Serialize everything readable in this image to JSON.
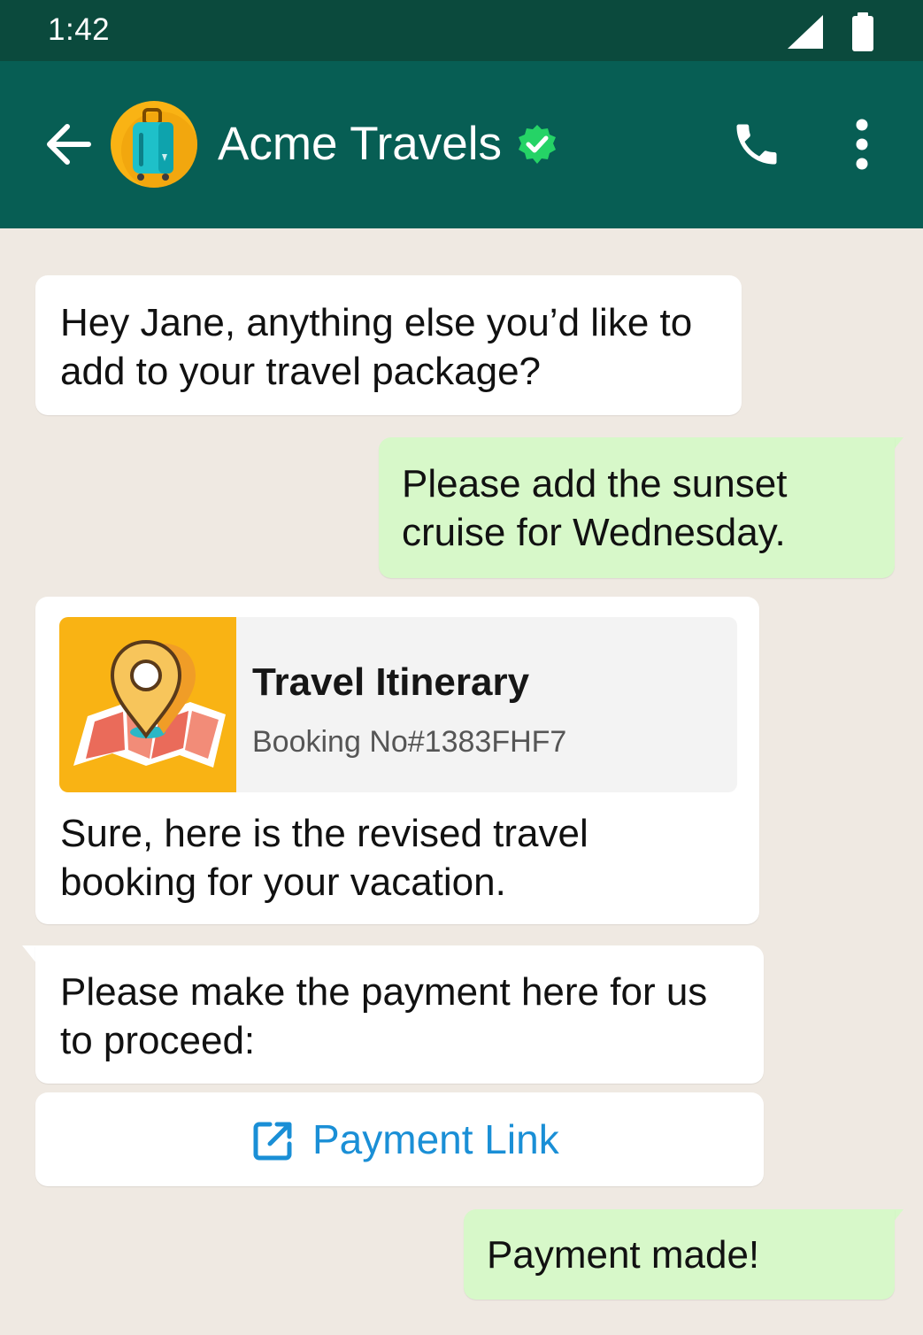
{
  "status_bar": {
    "time": "1:42",
    "signal_icon": "cellular-signal-icon",
    "battery_icon": "battery-icon"
  },
  "header": {
    "contact_name": "Acme Travels",
    "avatar_icon": "suitcase-icon",
    "verified_icon": "verified-badge-icon",
    "back_icon": "back-arrow-icon",
    "call_icon": "phone-call-icon",
    "menu_icon": "more-vert-icon"
  },
  "messages": [
    {
      "direction": "incoming",
      "text": "Hey Jane, anything else you’d like to\nadd to your travel package?"
    },
    {
      "direction": "outgoing",
      "text": "Please add the sunset\ncruise for Wednesday."
    },
    {
      "direction": "incoming",
      "card": {
        "title": "Travel Itinerary",
        "subtitle": "Booking No#1383FHF7",
        "icon": "map-pin-icon"
      },
      "text": "Sure, here is the revised travel\nbooking for your vacation."
    },
    {
      "direction": "incoming",
      "text": "Please make the payment here for us\nto proceed:"
    },
    {
      "direction": "outgoing",
      "text": "Payment made!"
    }
  ],
  "payment_button": {
    "label": "Payment Link",
    "icon": "external-link-icon"
  },
  "colors": {
    "status_bar": "#0b4a3d",
    "app_bar": "#075e54",
    "chat_background": "#efe9e2",
    "outgoing_bubble": "#d7f8c9",
    "incoming_bubble": "#ffffff",
    "link": "#1a8fd6",
    "verified": "#25d366",
    "avatar": "#f9b314"
  }
}
